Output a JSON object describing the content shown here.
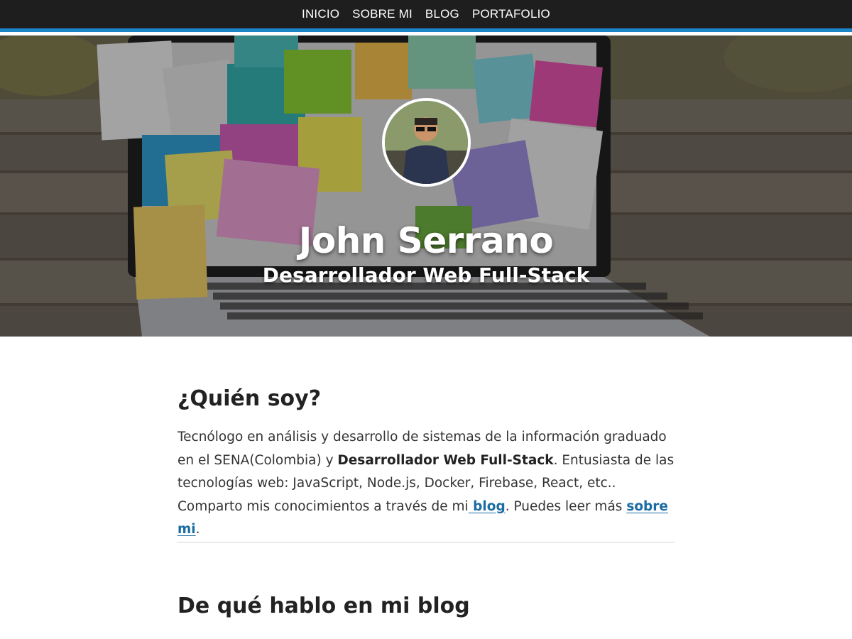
{
  "nav": {
    "items": [
      {
        "label": "INICIO"
      },
      {
        "label": "SOBRE MI"
      },
      {
        "label": "BLOG"
      },
      {
        "label": "PORTAFOLIO"
      }
    ]
  },
  "hero": {
    "name": "John Serrano",
    "subtitle": "Desarrollador Web Full-Stack"
  },
  "about": {
    "title": "¿Quién soy?",
    "text_1": "Tecnólogo en análisis y desarrollo de sistemas de la información graduado en el SENA(Colombia) y ",
    "bold_1": "Desarrollador Web Full-Stack",
    "text_2": ". Entusiasta de las tecnologías web: JavaScript, Node.js, Docker, Firebase, React, etc.. Comparto mis conocimientos a través de mi",
    "link_blog": " blog",
    "text_3": ". Puedes leer más ",
    "link_about": "sobre mi",
    "text_4": "."
  },
  "blog_section": {
    "title": "De qué hablo en mi blog"
  },
  "colors": {
    "nav_bg": "#1e1e1e",
    "accent": "#1b85c8",
    "link": "#1b6ca3"
  }
}
